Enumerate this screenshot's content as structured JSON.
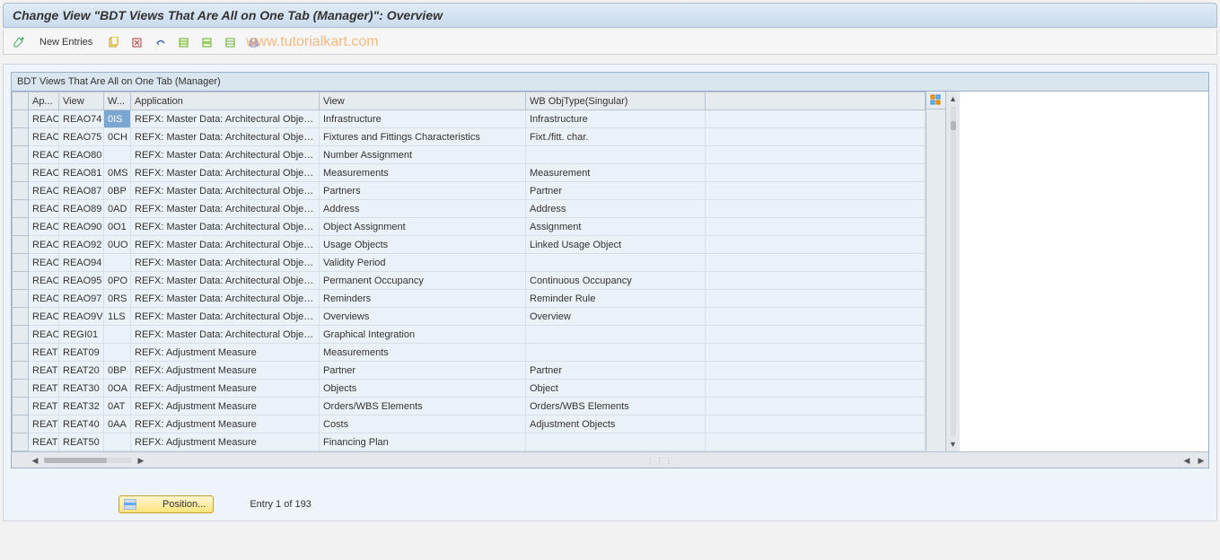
{
  "title": "Change View \"BDT Views That Are All on One Tab (Manager)\": Overview",
  "toolbar": {
    "new_entries": "New Entries",
    "watermark": "www.tutorialkart.com"
  },
  "table": {
    "title": "BDT Views That Are All on One Tab (Manager)",
    "cols": {
      "ap": "Ap...",
      "view": "View",
      "w": "W...",
      "application": "Application",
      "vw": "View",
      "obj": "WB ObjType(Singular)"
    },
    "rows": [
      {
        "ap": "REAO",
        "view": "REAO74",
        "w": "0IS",
        "application": "REFX: Master Data: Architectural Obje…",
        "vw": "Infrastructure",
        "obj": "Infrastructure",
        "sel": true
      },
      {
        "ap": "REAO",
        "view": "REAO75",
        "w": "0CH",
        "application": "REFX: Master Data: Architectural Obje…",
        "vw": "Fixtures and Fittings Characteristics",
        "obj": "Fixt./fitt. char."
      },
      {
        "ap": "REAO",
        "view": "REAO80",
        "w": "",
        "application": "REFX: Master Data: Architectural Obje…",
        "vw": "Number Assignment",
        "obj": ""
      },
      {
        "ap": "REAO",
        "view": "REAO81",
        "w": "0MS",
        "application": "REFX: Master Data: Architectural Obje…",
        "vw": "Measurements",
        "obj": "Measurement"
      },
      {
        "ap": "REAO",
        "view": "REAO87",
        "w": "0BP",
        "application": "REFX: Master Data: Architectural Obje…",
        "vw": "Partners",
        "obj": "Partner"
      },
      {
        "ap": "REAO",
        "view": "REAO89",
        "w": "0AD",
        "application": "REFX: Master Data: Architectural Obje…",
        "vw": "Address",
        "obj": "Address"
      },
      {
        "ap": "REAO",
        "view": "REAO90",
        "w": "0O1",
        "application": "REFX: Master Data: Architectural Obje…",
        "vw": "Object Assignment",
        "obj": "Assignment"
      },
      {
        "ap": "REAO",
        "view": "REAO92",
        "w": "0UO",
        "application": "REFX: Master Data: Architectural Obje…",
        "vw": "Usage Objects",
        "obj": "Linked Usage Object"
      },
      {
        "ap": "REAO",
        "view": "REAO94",
        "w": "",
        "application": "REFX: Master Data: Architectural Obje…",
        "vw": "Validity Period",
        "obj": ""
      },
      {
        "ap": "REAO",
        "view": "REAO95",
        "w": "0PO",
        "application": "REFX: Master Data: Architectural Obje…",
        "vw": "Permanent Occupancy",
        "obj": "Continuous Occupancy"
      },
      {
        "ap": "REAO",
        "view": "REAO97",
        "w": "0RS",
        "application": "REFX: Master Data: Architectural Obje…",
        "vw": "Reminders",
        "obj": "Reminder Rule"
      },
      {
        "ap": "REAO",
        "view": "REAO9V",
        "w": "1LS",
        "application": "REFX: Master Data: Architectural Obje…",
        "vw": "Overviews",
        "obj": "Overview"
      },
      {
        "ap": "REAO",
        "view": "REGI01",
        "w": "",
        "application": "REFX: Master Data: Architectural Obje…",
        "vw": "Graphical Integration",
        "obj": ""
      },
      {
        "ap": "REAT",
        "view": "REAT09",
        "w": "",
        "application": "REFX: Adjustment Measure",
        "vw": "Measurements",
        "obj": ""
      },
      {
        "ap": "REAT",
        "view": "REAT20",
        "w": "0BP",
        "application": "REFX: Adjustment Measure",
        "vw": "Partner",
        "obj": "Partner"
      },
      {
        "ap": "REAT",
        "view": "REAT30",
        "w": "0OA",
        "application": "REFX: Adjustment Measure",
        "vw": "Objects",
        "obj": "Object"
      },
      {
        "ap": "REAT",
        "view": "REAT32",
        "w": "0AT",
        "application": "REFX: Adjustment Measure",
        "vw": "Orders/WBS Elements",
        "obj": "Orders/WBS Elements"
      },
      {
        "ap": "REAT",
        "view": "REAT40",
        "w": "0AA",
        "application": "REFX: Adjustment Measure",
        "vw": "Costs",
        "obj": "Adjustment Objects"
      },
      {
        "ap": "REAT",
        "view": "REAT50",
        "w": "",
        "application": "REFX: Adjustment Measure",
        "vw": "Financing Plan",
        "obj": ""
      }
    ]
  },
  "footer": {
    "position": "Position...",
    "entry": "Entry 1 of 193"
  }
}
